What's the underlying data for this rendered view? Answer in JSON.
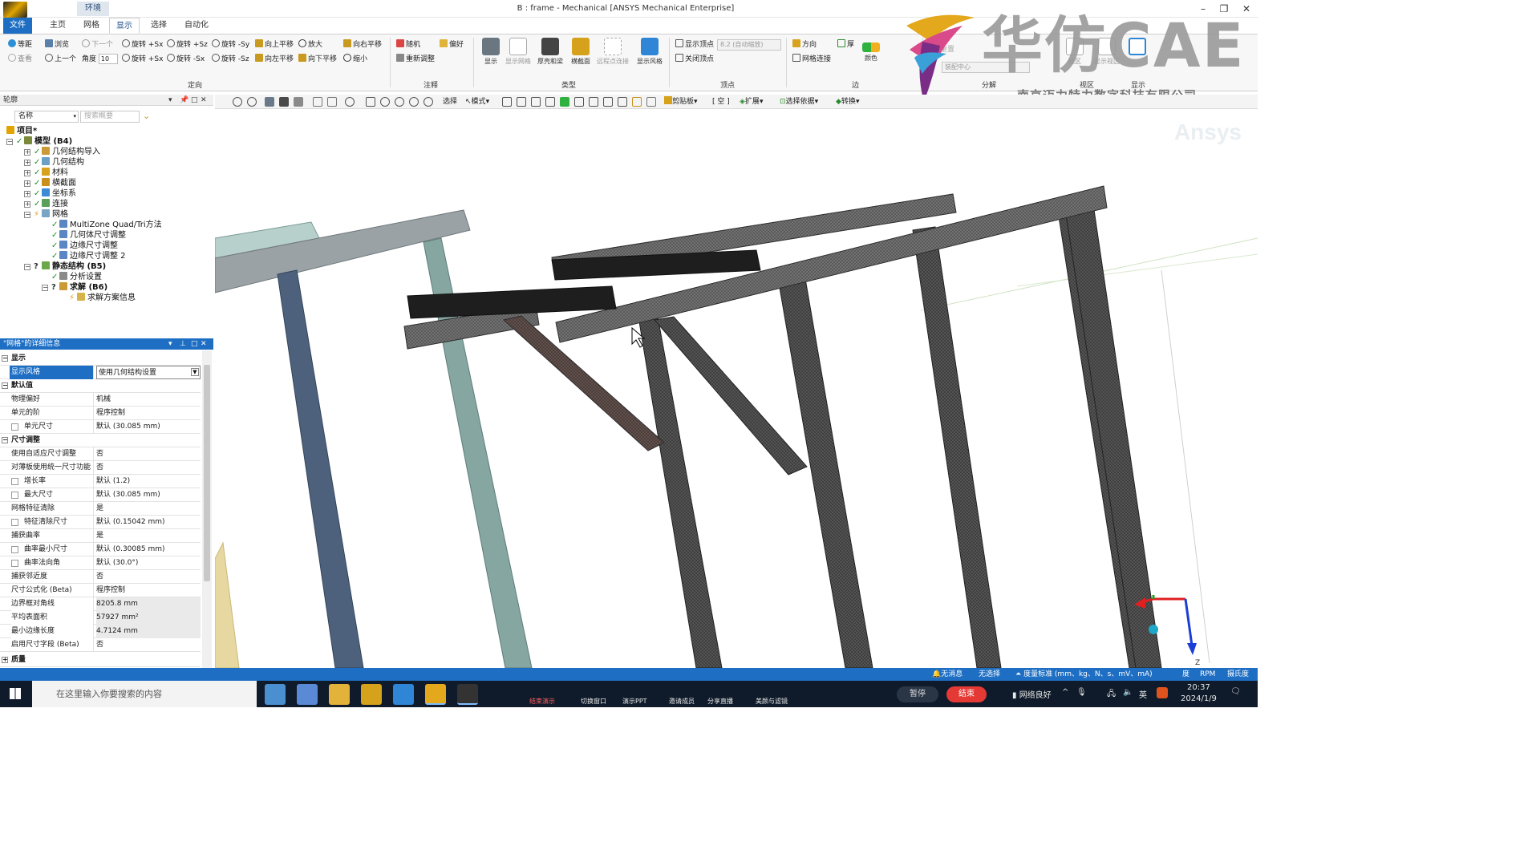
{
  "window": {
    "title": "B : frame - Mechanical [ANSYS Mechanical Enterprise]",
    "context_tab": "环境"
  },
  "ribbon_tabs": [
    "文件",
    "主页",
    "网格",
    "显示",
    "选择",
    "自动化"
  ],
  "ribbon": {
    "orient": {
      "row1": [
        "等距",
        "浏览",
        "下一个",
        "旋转 +Sx",
        "旋转 +Sz",
        "旋转 -Sy",
        "向上平移",
        "放大",
        "向右平移"
      ],
      "row2": [
        "查看",
        "上一个",
        "角度",
        "旋转 +Sx",
        "旋转 -Sx",
        "旋转 -Sz",
        "向左平移",
        "向下平移",
        "缩小"
      ],
      "angle_value": "10",
      "group_label": "定向"
    },
    "annotation": {
      "items": [
        "随机",
        "偏好",
        "重新调整"
      ],
      "group_label": "注释"
    },
    "type": {
      "buttons": [
        "显示",
        "显示网格",
        "厚壳和梁",
        "横截面",
        "远程点连接",
        "显示风格"
      ],
      "group_label": "类型"
    },
    "vertex": {
      "items": [
        "显示顶点",
        "关闭顶点"
      ],
      "combo_value": "8.2 (自动缩放)",
      "group_label": "顶点"
    },
    "edge": {
      "items": [
        "方向",
        "厚",
        "网格连接",
        "颜色"
      ],
      "group_label": "边"
    },
    "explode": {
      "items": [
        "重置",
        "装配中心"
      ],
      "group_label": "分解"
    },
    "viewport": {
      "group_label": "视区",
      "items": [
        "视区",
        "显示视区"
      ]
    },
    "display": {
      "group_label": "显示"
    }
  },
  "watermark": {
    "brand": "华仿CAE",
    "company": "南京迈力特力数字科技有限公司"
  },
  "outline": {
    "title": "轮廓",
    "filter_label": "名称",
    "search_placeholder": "搜索概要",
    "tree": [
      {
        "label": "项目*",
        "level": 0,
        "bold": true
      },
      {
        "label": "模型 (B4)",
        "level": 1,
        "bold": true
      },
      {
        "label": "几何结构导入",
        "level": 2
      },
      {
        "label": "几何结构",
        "level": 2
      },
      {
        "label": "材料",
        "level": 2
      },
      {
        "label": "横截面",
        "level": 2
      },
      {
        "label": "坐标系",
        "level": 2
      },
      {
        "label": "连接",
        "level": 2
      },
      {
        "label": "网格",
        "level": 2
      },
      {
        "label": "MultiZone Quad/Tri方法",
        "level": 3
      },
      {
        "label": "几何体尺寸调整",
        "level": 3
      },
      {
        "label": "边缘尺寸调整",
        "level": 3
      },
      {
        "label": "边缘尺寸调整 2",
        "level": 3
      },
      {
        "label": "静态结构 (B5)",
        "level": 2,
        "bold": true
      },
      {
        "label": "分析设置",
        "level": 3
      },
      {
        "label": "求解 (B6)",
        "level": 3,
        "bold": true
      },
      {
        "label": "求解方案信息",
        "level": 4
      }
    ]
  },
  "details": {
    "title": "\"网格\"的详细信息",
    "rows": [
      {
        "type": "section",
        "key": "显示"
      },
      {
        "type": "row",
        "key": "显示风格",
        "value": "使用几何结构设置",
        "highlight": true
      },
      {
        "type": "section",
        "key": "默认值"
      },
      {
        "type": "row",
        "key": "物理偏好",
        "value": "机械"
      },
      {
        "type": "row",
        "key": "单元的阶",
        "value": "程序控制"
      },
      {
        "type": "row",
        "key": "单元尺寸",
        "value": "默认 (30.085 mm)",
        "cb": true
      },
      {
        "type": "section",
        "key": "尺寸调整"
      },
      {
        "type": "row",
        "key": "使用自适应尺寸调整",
        "value": "否"
      },
      {
        "type": "row",
        "key": "对薄板使用统一尺寸功能",
        "value": "否"
      },
      {
        "type": "row",
        "key": "增长率",
        "value": "默认 (1.2)",
        "cb": true
      },
      {
        "type": "row",
        "key": "最大尺寸",
        "value": "默认 (30.085 mm)",
        "cb": true
      },
      {
        "type": "row",
        "key": "网格特征清除",
        "value": "是"
      },
      {
        "type": "row",
        "key": "特征清除尺寸",
        "value": "默认 (0.15042 mm)",
        "cb": true
      },
      {
        "type": "row",
        "key": "捕获曲率",
        "value": "是"
      },
      {
        "type": "row",
        "key": "曲率最小尺寸",
        "value": "默认 (0.30085 mm)",
        "cb": true
      },
      {
        "type": "row",
        "key": "曲率法向角",
        "value": "默认 (30.0°)",
        "cb": true
      },
      {
        "type": "row",
        "key": "捕获邻近度",
        "value": "否"
      },
      {
        "type": "row",
        "key": "尺寸公式化 (Beta)",
        "value": "程序控制"
      },
      {
        "type": "row",
        "key": "边界框对角线",
        "value": "8205.8 mm",
        "gray": true
      },
      {
        "type": "row",
        "key": "平均表面积",
        "value": "57927 mm²",
        "gray": true
      },
      {
        "type": "row",
        "key": "最小边缘长度",
        "value": "4.7124 mm",
        "gray": true
      },
      {
        "type": "row",
        "key": "启用尺寸字段 (Beta)",
        "value": "否"
      },
      {
        "type": "section",
        "key": "质量",
        "collapsed": true
      }
    ]
  },
  "graphics_toolbar": {
    "select": "选择",
    "mode": "模式",
    "clipboard": "剪贴板",
    "empty": "[ 空 ]",
    "extend": "扩展",
    "select_by": "选择依据",
    "convert": "转换"
  },
  "status": {
    "messages": "无消息",
    "selection": "无选择",
    "units": "度量标准 (mm、kg、N、s、mV、mA)",
    "angle": "度",
    "speed": "RPM",
    "temp": "摄氏度"
  },
  "taskbar": {
    "search_placeholder": "在这里输入你要搜索的内容",
    "meeting_items": [
      "结束演示",
      "切换窗口",
      "演示PPT",
      "邀请成员",
      "分享直播",
      "美颜与滤镜"
    ],
    "pause": "暂停",
    "end": "结束",
    "network": "网络良好",
    "lang": "英",
    "time": "20:37",
    "date": "2024/1/9"
  },
  "axis": {
    "z_label": "Z"
  },
  "colors": {
    "accent_blue": "#1e6fc4",
    "mesh_dark": "#3d3d3d",
    "beam_light": "#8a969c",
    "beam_blue": "#4c5f7a",
    "beam_teal": "#86a6a2"
  }
}
